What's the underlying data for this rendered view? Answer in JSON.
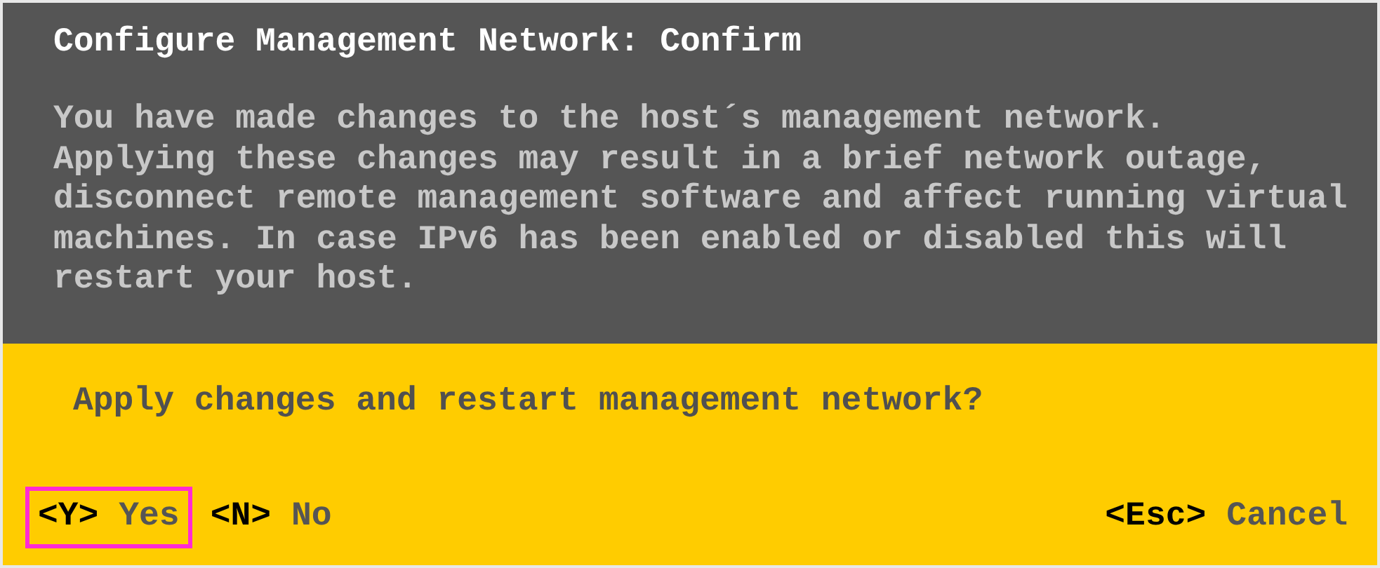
{
  "dialog": {
    "title": "Configure Management Network: Confirm",
    "message": "You have made changes to the host´s management network.\nApplying these changes may result in a brief network outage,\ndisconnect remote management software and affect running virtual\nmachines. In case IPv6 has been enabled or disabled this will\nrestart your host.",
    "question": "Apply changes and restart management network?",
    "left_actions": [
      {
        "key": "<Y>",
        "label": "Yes",
        "highlighted": true
      },
      {
        "key": "<N>",
        "label": "No",
        "highlighted": false
      }
    ],
    "right_actions": [
      {
        "key": "<Esc>",
        "label": "Cancel",
        "highlighted": false
      }
    ]
  }
}
